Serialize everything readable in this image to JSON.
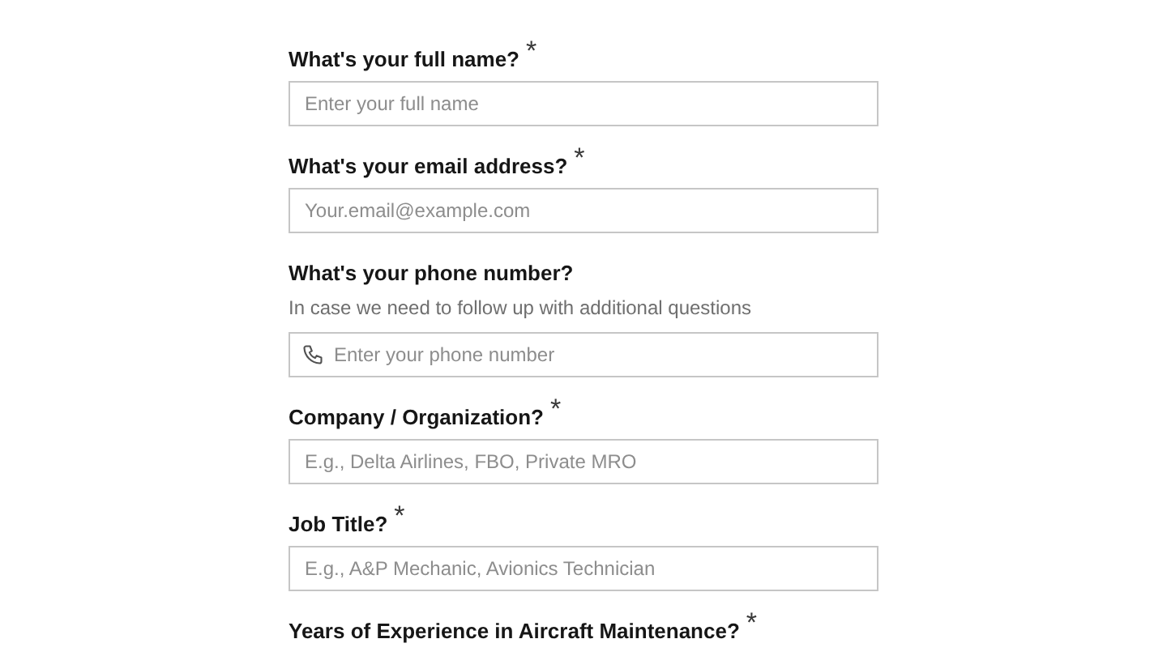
{
  "fields": [
    {
      "kind": "text",
      "label": "What's your full name?",
      "required_mark": "*",
      "placeholder": "Enter your full name"
    },
    {
      "kind": "text",
      "label": "What's your email address?",
      "required_mark": "*",
      "placeholder": "Your.email@example.com"
    },
    {
      "kind": "phone",
      "label": "What's your phone number?",
      "hint": "In case we need to follow up with additional questions",
      "placeholder": "Enter your phone number"
    },
    {
      "kind": "text",
      "label": "Company / Organization?",
      "required_mark": "*",
      "placeholder": "E.g., Delta Airlines, FBO, Private MRO"
    },
    {
      "kind": "text",
      "label": "Job Title?",
      "required_mark": "*",
      "placeholder": "E.g., A&P Mechanic, Avionics Technician"
    },
    {
      "kind": "heading",
      "label": "Years of Experience in Aircraft Maintenance?",
      "required_mark": "*"
    }
  ]
}
